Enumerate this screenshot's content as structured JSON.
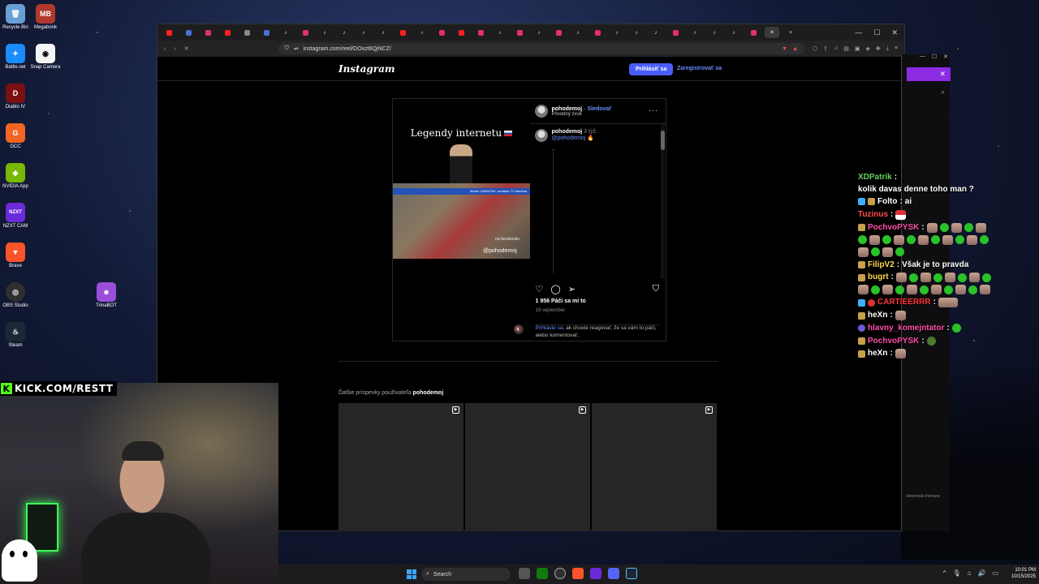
{
  "desktop": {
    "icons": [
      {
        "label": "Recycle Bin",
        "color": "#6a9fd6"
      },
      {
        "label": "Megabonk",
        "color": "#b0382a"
      },
      {
        "label": "Battle.net",
        "color": "#1a8cff"
      },
      {
        "label": "Snap Camera",
        "color": "#f5f5f5"
      },
      {
        "label": "Diablo IV",
        "color": "#7a1010"
      },
      {
        "label": "GCC",
        "color": "#f26522"
      },
      {
        "label": "NVIDIA App",
        "color": "#76b900"
      },
      {
        "label": "NZXT CAM",
        "color": "#6b2bd9"
      },
      {
        "label": "Brave",
        "color": "#fb542b"
      },
      {
        "label": "OBS Studio",
        "color": "#302e31"
      },
      {
        "label": "Steam",
        "color": "#1b2838"
      },
      {
        "label": "TrinaBOT",
        "color": "#9b4fd9"
      }
    ]
  },
  "browser": {
    "url": "instagram.com/reel/DOxzt6QjNCZ/",
    "tab_count": 32
  },
  "instagram": {
    "logo": "Instagram",
    "login_button": "Prihlásiť sa",
    "register_link": "Zaregistrovať sa",
    "post": {
      "username": "pohodemoj",
      "follow": "Sledovať",
      "audio": "Pôvodný zvuk",
      "video_title": "Legendy internetu",
      "video_caption": "Marek VNENČÁK, redaktor TV Markíza",
      "video_source": "na facebooku",
      "video_handle": "@pohodemoj",
      "comment_user": "pohodemoj",
      "comment_time": "3 týž.",
      "comment_mention": "@pohodemoj",
      "likes": "1 956 Páči sa mi to",
      "date": "19 september",
      "login_note_link": "Prihláste sa",
      "login_note_text": ", ak chcete reagovať, že sa vám to páči, alebo komentovať."
    },
    "more_posts_prefix": "Ďalšie príspevky používateľa",
    "more_posts_user": "pohodemoj"
  },
  "kick_panel": {
    "bottom_text": "slowmode Immune"
  },
  "stream": {
    "banner": "KICK.COM/RESTT"
  },
  "chat": [
    {
      "user": "XDPatrik",
      "color": "#5fd35f",
      "text": "kolik davas denne toho man ?"
    },
    {
      "user": "Folto",
      "color": "#ffffff",
      "text": "ai"
    },
    {
      "user": "Tuzinus",
      "color": "#ff4d4d",
      "text": ""
    },
    {
      "user": "PochvoPYSK",
      "color": "#ff4da6",
      "text": ""
    },
    {
      "user": "FilipV2",
      "color": "#ffd84d",
      "text": "Však je to pravda"
    },
    {
      "user": "bugrt",
      "color": "#ffd84d",
      "text": ""
    },
    {
      "user": "CARTIEERRR",
      "color": "#ff3333",
      "text": ""
    },
    {
      "user": "heXn",
      "color": "#ffffff",
      "text": ""
    },
    {
      "user": "hlavny_komejntator",
      "color": "#ff4da6",
      "text": ""
    },
    {
      "user": "PochvoPYSK",
      "color": "#ff4da6",
      "text": ""
    },
    {
      "user": "heXn",
      "color": "#ffffff",
      "text": ""
    }
  ],
  "taskbar": {
    "search_placeholder": "Search",
    "time": "10:01 PM",
    "date": "10/15/2025"
  }
}
